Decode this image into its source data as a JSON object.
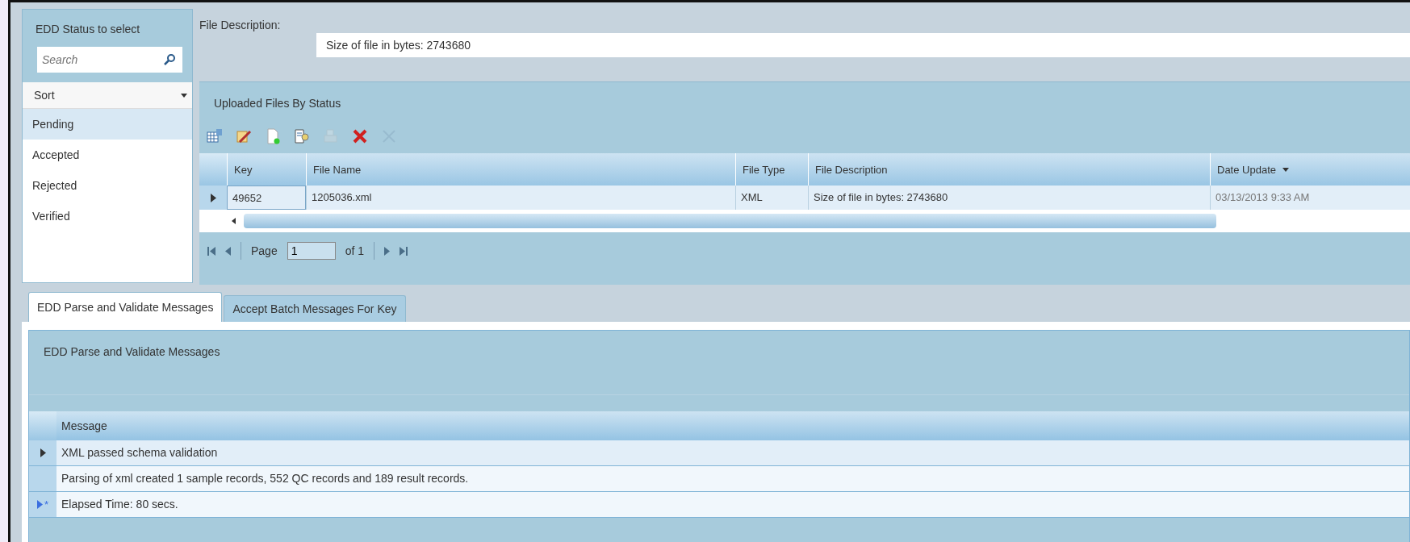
{
  "status_panel": {
    "title": "EDD Status to select",
    "search": {
      "placeholder": "Search"
    },
    "sort": {
      "value": "Sort"
    },
    "items": [
      {
        "label": "Pending",
        "selected": true
      },
      {
        "label": "Accepted",
        "selected": false
      },
      {
        "label": "Rejected",
        "selected": false
      },
      {
        "label": "Verified",
        "selected": false
      }
    ]
  },
  "file_description": {
    "label": "File Description:",
    "value": "Size of file in bytes: 2743680"
  },
  "uploaded_files": {
    "title": "Uploaded Files By Status",
    "toolbar": [
      {
        "kind": "grid",
        "disabled": false
      },
      {
        "kind": "edit",
        "disabled": false
      },
      {
        "kind": "new",
        "disabled": false
      },
      {
        "kind": "view",
        "disabled": false
      },
      {
        "kind": "print",
        "disabled": true
      },
      {
        "kind": "delete",
        "disabled": false
      },
      {
        "kind": "cancel",
        "disabled": true
      }
    ],
    "columns": [
      {
        "label": "Key",
        "sorted": false
      },
      {
        "label": "File Name",
        "sorted": false
      },
      {
        "label": "File Type",
        "sorted": false
      },
      {
        "label": "File Description",
        "sorted": false
      },
      {
        "label": "Date Update",
        "sorted": true
      }
    ],
    "rows": [
      {
        "selected": true,
        "cells": [
          "49652",
          "1205036.xml",
          "XML",
          "Size of file in bytes: 2743680",
          "03/13/2013 9:33 AM"
        ]
      }
    ],
    "pager": {
      "page_label": "Page",
      "page": "1",
      "of": "of 1"
    }
  },
  "tabs": [
    {
      "label": "EDD Parse and Validate Messages",
      "selected": true
    },
    {
      "label": "Accept Batch Messages For Key",
      "selected": false
    }
  ],
  "messages": {
    "title": "EDD Parse and Validate Messages",
    "column": "Message",
    "rows": [
      {
        "text": "XML passed schema validation",
        "selected": true
      },
      {
        "text": "Parsing of xml created 1 sample records, 552 QC records and 189 result records.",
        "selected": false
      },
      {
        "text": "Elapsed Time: 80 secs.",
        "selected": false,
        "marker": "*"
      }
    ]
  }
}
